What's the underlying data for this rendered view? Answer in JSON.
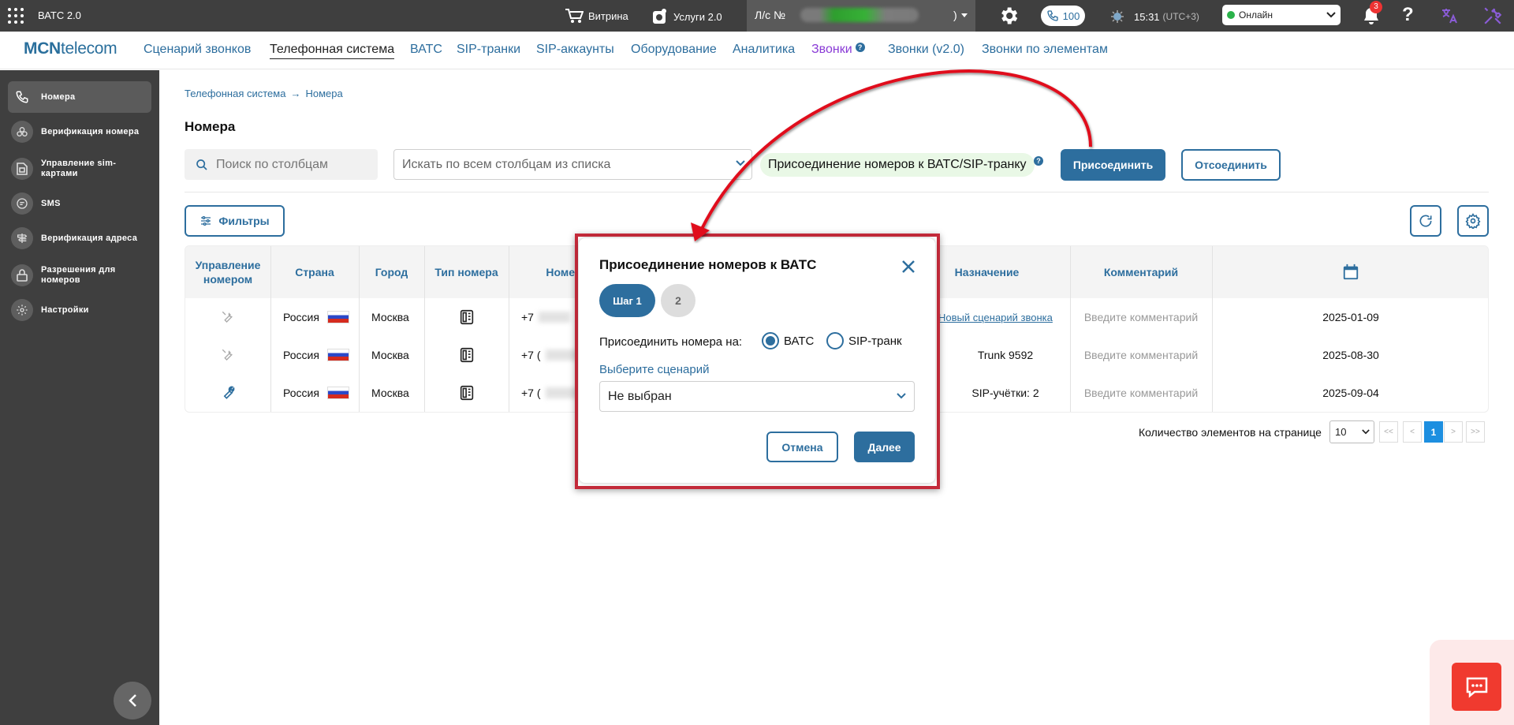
{
  "topbar": {
    "app_name": "ВАТС 2.0",
    "showcase": "Витрина",
    "services": "Услуги 2.0",
    "account_prefix": "Л/с №",
    "account_suffix": ")",
    "calls_count": "100",
    "time": "15:31",
    "timezone": "(UTC+3)",
    "status": "Онлайн",
    "notifications": "3",
    "help": "?"
  },
  "nav": {
    "logo_bold": "MCN",
    "logo_rest": "telecom",
    "items": [
      "Сценарий звонков",
      "Телефонная система",
      "ВАТС",
      "SIP-транки",
      "SIP-аккаунты",
      "Оборудование",
      "Аналитика",
      "Звонки",
      "Звонки (v2.0)",
      "Звонки по элементам"
    ],
    "active": "Телефонная система",
    "badge_q": "?"
  },
  "sidebar": {
    "items": [
      {
        "label": "Номера",
        "icon": "phone-icon"
      },
      {
        "label": "Верификация номера",
        "icon": "fingerprint-icon"
      },
      {
        "label": "Управление sim-картами",
        "icon": "sim-card-icon"
      },
      {
        "label": "SMS",
        "icon": "message-icon"
      },
      {
        "label": "Верификация адреса",
        "icon": "signpost-icon"
      },
      {
        "label": "Разрешения для номеров",
        "icon": "lock-icon"
      },
      {
        "label": "Настройки",
        "icon": "gear-icon"
      }
    ]
  },
  "main": {
    "breadcrumb": [
      "Телефонная система",
      "Номера"
    ],
    "title": "Номера",
    "search_placeholder": "Поиск по столбцам",
    "search_all_placeholder": "Искать по всем столбцам из списка",
    "join_label": "Присоединение номеров к ВАТС/SIP-транку",
    "join_button": "Присоединить",
    "detach_button": "Отсоединить",
    "filters_button": "Фильтры"
  },
  "table": {
    "headers": [
      "Управление номером",
      "Страна",
      "Город",
      "Тип номера",
      "Номер",
      "Назначение",
      "Комментарий"
    ],
    "rows": [
      {
        "country": "Россия",
        "city": "Москва",
        "number": "+7",
        "purpose": "Новый сценарий звонка",
        "purpose_link": true,
        "comment": "Введите комментарий",
        "date": "2025-01-09",
        "tool_active": false
      },
      {
        "country": "Россия",
        "city": "Москва",
        "number": "+7 (",
        "purpose": "Trunk 9592",
        "purpose_link": false,
        "comment": "Введите комментарий",
        "date": "2025-08-30",
        "tool_active": false
      },
      {
        "country": "Россия",
        "city": "Москва",
        "number": "+7 (",
        "purpose": "SIP-учётки: 2",
        "purpose_link": false,
        "comment": "Введите комментарий",
        "date": "2025-09-04",
        "tool_active": true
      }
    ]
  },
  "pagination": {
    "label": "Количество элементов на странице",
    "page_size": "10",
    "first": "<<",
    "prev": "<",
    "current": "1",
    "next": ">",
    "last": ">>"
  },
  "modal": {
    "title": "Присоединение номеров к ВАТС",
    "step1": "Шаг 1",
    "step2": "2",
    "join_to": "Присоединить номера на:",
    "option_vats": "ВАТС",
    "option_sip": "SIP-транк",
    "selected_option": "ВАТС",
    "scenario_label": "Выберите сценарий",
    "scenario_value": "Не выбран",
    "cancel": "Отмена",
    "next": "Далее"
  },
  "colors": {
    "accent": "#2d6e9e",
    "highlight_frame": "#c42a3a",
    "arrow": "#e0101e",
    "join_label_bg": "#e9f8e6"
  }
}
